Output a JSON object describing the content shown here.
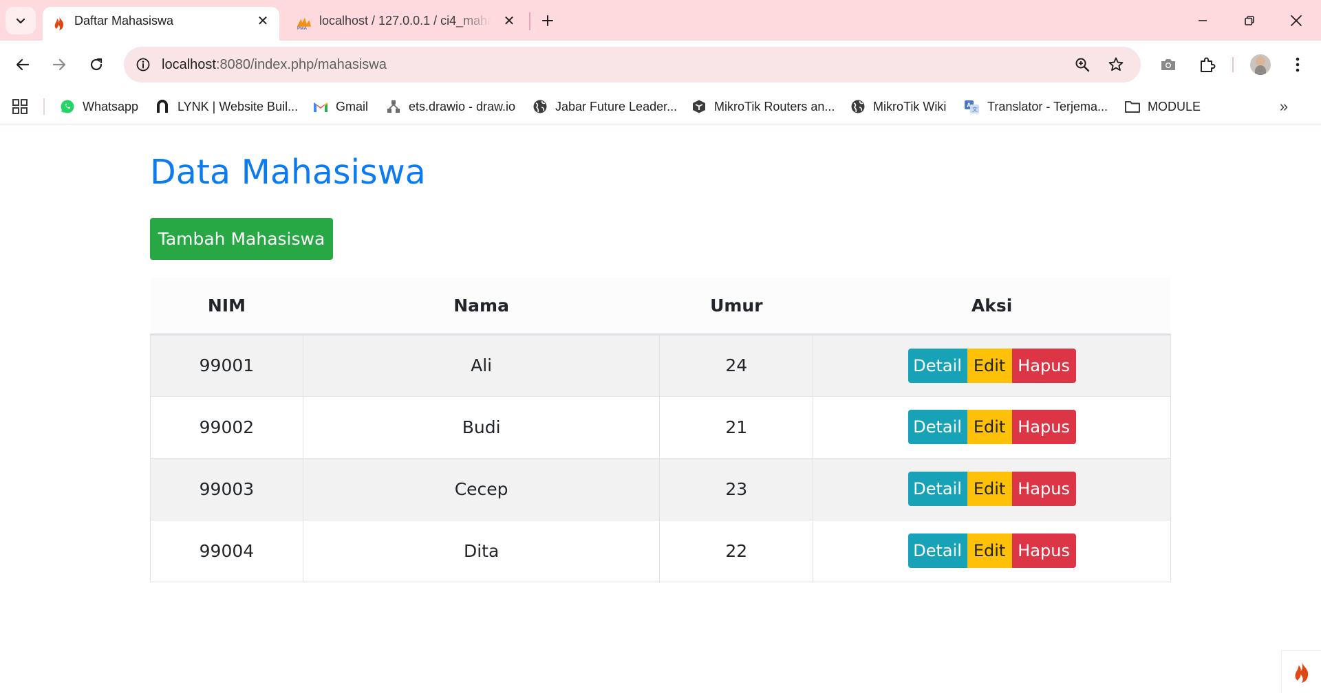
{
  "browser": {
    "tabs": [
      {
        "title": "Daftar Mahasiswa",
        "active": true,
        "favicon": "codeigniter-flame-icon"
      },
      {
        "title": "localhost / 127.0.0.1 / ci4_mahasiswa",
        "active": false,
        "favicon": "phpmyadmin-icon"
      }
    ],
    "address": {
      "host": "localhost",
      "path": ":8080/index.php/mahasiswa"
    },
    "bookmarks": [
      {
        "label": "Whatsapp",
        "icon": "whatsapp-icon"
      },
      {
        "label": "LYNK | Website Buil...",
        "icon": "lynk-icon"
      },
      {
        "label": "Gmail",
        "icon": "gmail-icon"
      },
      {
        "label": "ets.drawio - draw.io",
        "icon": "drawio-icon"
      },
      {
        "label": "Jabar Future Leader...",
        "icon": "globe-icon"
      },
      {
        "label": "MikroTik Routers an...",
        "icon": "mikrotik-icon"
      },
      {
        "label": "MikroTik Wiki",
        "icon": "globe-icon"
      },
      {
        "label": "Translator - Terjema...",
        "icon": "translator-icon"
      },
      {
        "label": "MODULE",
        "icon": "folder-icon"
      }
    ],
    "colors": {
      "tabbar": "#fed9dd",
      "omnibox": "#f9e4e7"
    }
  },
  "page": {
    "title": "Data Mahasiswa",
    "add_button": "Tambah Mahasiswa",
    "table": {
      "headers": [
        "NIM",
        "Nama",
        "Umur",
        "Aksi"
      ],
      "rows": [
        {
          "nim": "99001",
          "nama": "Ali",
          "umur": "24"
        },
        {
          "nim": "99002",
          "nama": "Budi",
          "umur": "21"
        },
        {
          "nim": "99003",
          "nama": "Cecep",
          "umur": "23"
        },
        {
          "nim": "99004",
          "nama": "Dita",
          "umur": "22"
        }
      ],
      "actions": {
        "detail": "Detail",
        "edit": "Edit",
        "hapus": "Hapus"
      }
    },
    "colors": {
      "title": "#0d7bf0",
      "success": "#28a745",
      "info": "#17a2b8",
      "warning": "#ffc107",
      "danger": "#dc3545"
    }
  }
}
